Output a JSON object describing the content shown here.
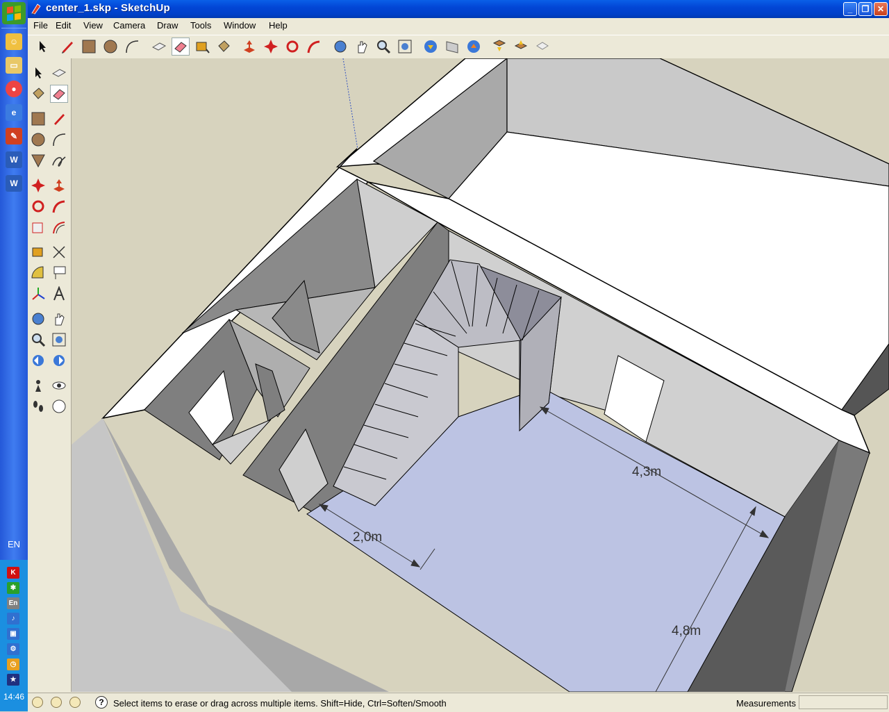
{
  "window": {
    "title": "center_1.skp - SketchUp",
    "minimize": "_",
    "maximize": "❐",
    "close": "✕"
  },
  "menu": [
    "File",
    "Edit",
    "View",
    "Camera",
    "Draw",
    "Tools",
    "Window",
    "Help"
  ],
  "status": {
    "message": "Select items to erase or drag across multiple items. Shift=Hide, Ctrl=Soften/Smooth",
    "help": "?",
    "measurements_label": "Measurements",
    "measurements_value": ""
  },
  "dimensions": {
    "width": "2,0m",
    "depth": "4,3m",
    "length": "4,8m"
  },
  "taskbar": {
    "language": "EN",
    "tray_language": "En",
    "clock": "14:46"
  },
  "colors": {
    "floor": "#bcc3e3",
    "wall_top": "#ffffff",
    "wall_dark": "#7f7f7f",
    "wall_mid": "#a9a9a9",
    "wall_light": "#cfcfcf",
    "background": "#d7d3be"
  }
}
